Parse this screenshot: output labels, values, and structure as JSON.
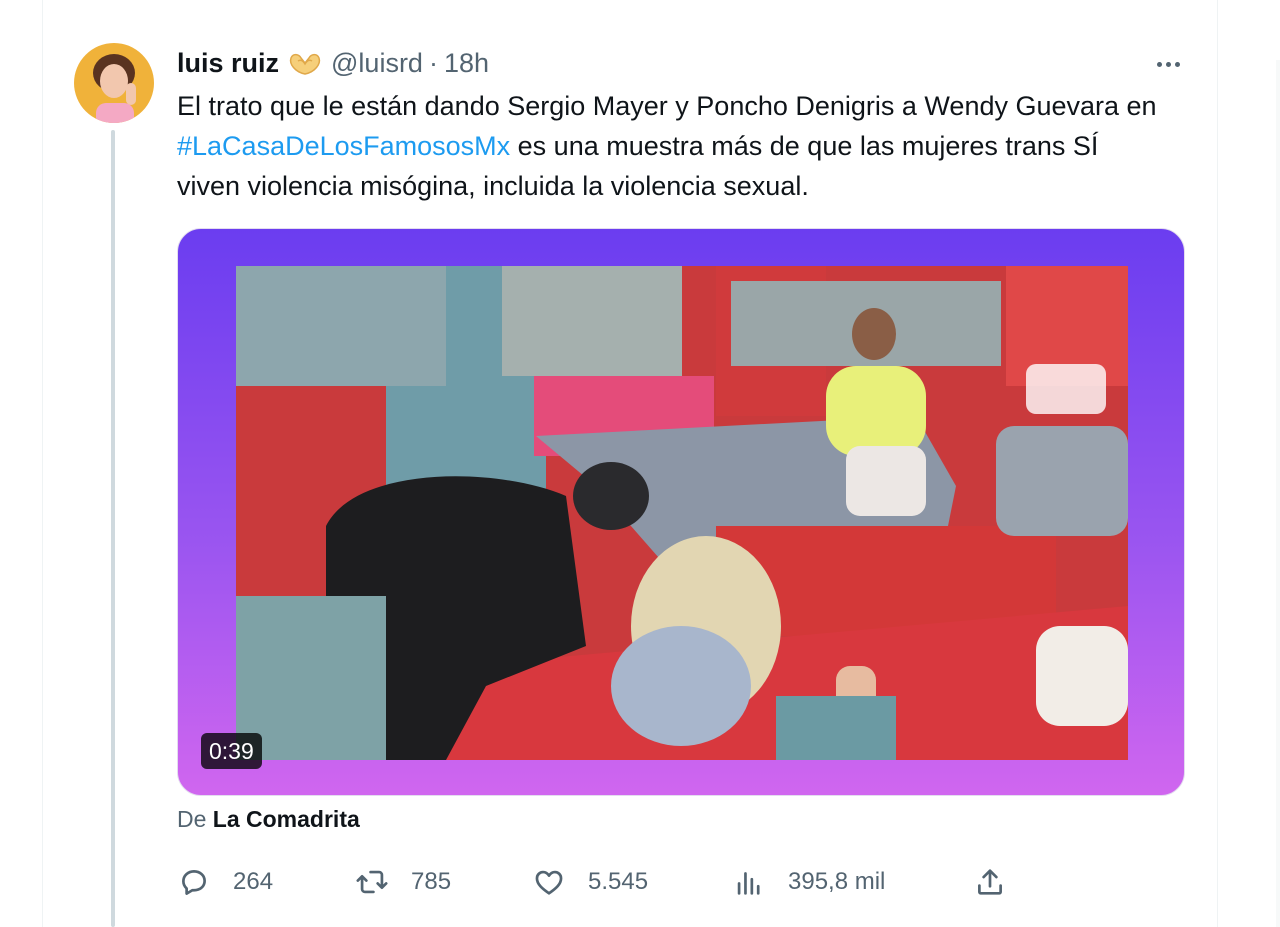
{
  "tweet": {
    "author_name": "luis ruiz",
    "author_emoji": "heart-hands-emoji",
    "handle": "@luisrd",
    "separator": "·",
    "time": "18h",
    "text_before": "El trato que le están dando Sergio Mayer y Poncho Denigris a Wendy Guevara en ",
    "hashtag": "#LaCasaDeLosFamososMx",
    "text_after": " es una muestra más de que las mujeres trans SÍ viven violencia misógina, incluida la violencia sexual."
  },
  "media": {
    "duration": "0:39"
  },
  "source": {
    "prefix": "De",
    "name": "La Comadrita"
  },
  "actions": {
    "replies": "264",
    "retweets": "785",
    "likes": "5.545",
    "views": "395,8 mil"
  },
  "colors": {
    "accent": "#1d9bf0",
    "secondary_text": "#536471",
    "media_gradient_top": "#6b3df0",
    "media_gradient_bottom": "#d066ef"
  }
}
